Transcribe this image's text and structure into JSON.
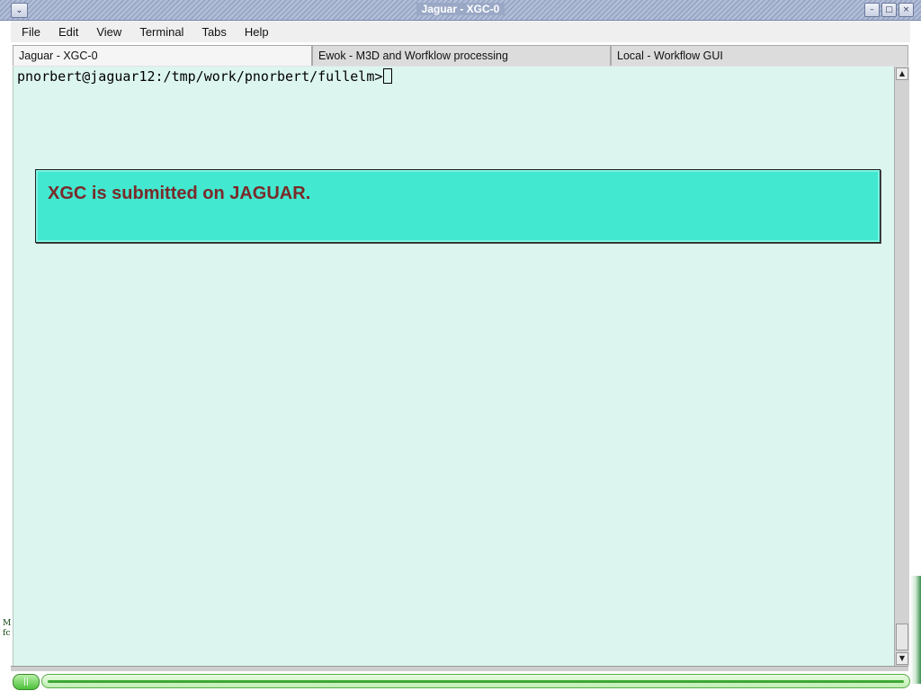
{
  "window": {
    "title": "Jaguar - XGC-0"
  },
  "menubar": {
    "items": [
      {
        "label": "File"
      },
      {
        "label": "Edit"
      },
      {
        "label": "View"
      },
      {
        "label": "Terminal"
      },
      {
        "label": "Tabs"
      },
      {
        "label": "Help"
      }
    ]
  },
  "tabs": [
    {
      "label": "Jaguar - XGC-0",
      "active": true
    },
    {
      "label": "Ewok - M3D and Worfklow processing",
      "active": false
    },
    {
      "label": "Local - Workflow GUI",
      "active": false
    }
  ],
  "terminal": {
    "prompt": "pnorbert@jaguar12:/tmp/work/pnorbert/fullelm>",
    "background_color": "#dcf5ef"
  },
  "message": {
    "text": "XGC is submitted on JAGUAR.",
    "background_color": "#42e8d0",
    "text_color": "#7a2a2a"
  },
  "side_text": {
    "line1": "M",
    "line2": "fc"
  },
  "icons": {
    "window_menu": "chevron-down-icon",
    "minimize": "minimize-icon",
    "maximize": "maximize-icon",
    "close": "close-icon",
    "scroll_up": "arrow-up-icon",
    "scroll_down": "arrow-down-icon"
  }
}
